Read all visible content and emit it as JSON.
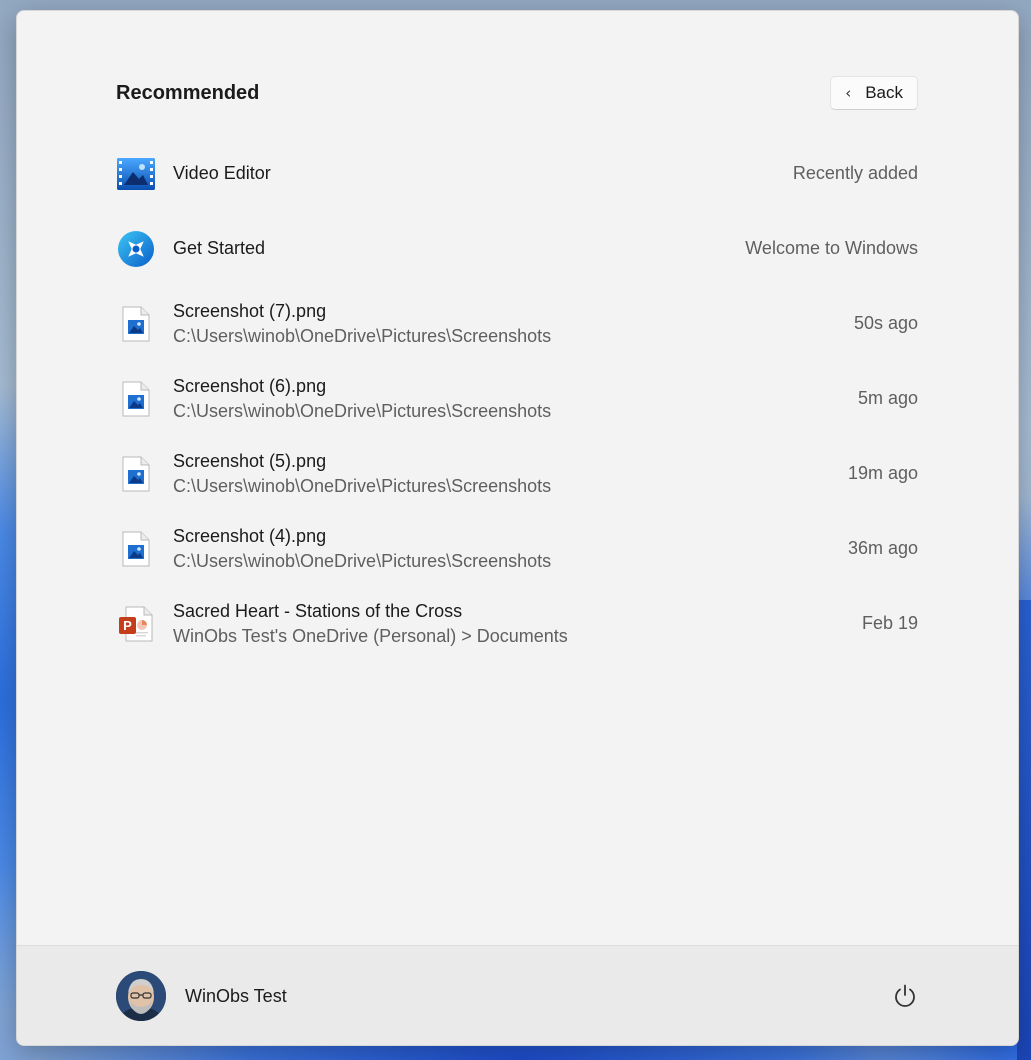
{
  "recommended": {
    "title": "Recommended",
    "back_label": "Back"
  },
  "items": [
    {
      "name": "Video Editor",
      "path": "",
      "meta": "Recently added",
      "icon": "video-editor-icon"
    },
    {
      "name": "Get Started",
      "path": "",
      "meta": "Welcome to Windows",
      "icon": "get-started-icon"
    },
    {
      "name": "Screenshot (7).png",
      "path": "C:\\Users\\winob\\OneDrive\\Pictures\\Screenshots",
      "meta": "50s ago",
      "icon": "image-file-icon"
    },
    {
      "name": "Screenshot (6).png",
      "path": "C:\\Users\\winob\\OneDrive\\Pictures\\Screenshots",
      "meta": "5m ago",
      "icon": "image-file-icon"
    },
    {
      "name": "Screenshot (5).png",
      "path": "C:\\Users\\winob\\OneDrive\\Pictures\\Screenshots",
      "meta": "19m ago",
      "icon": "image-file-icon"
    },
    {
      "name": "Screenshot (4).png",
      "path": "C:\\Users\\winob\\OneDrive\\Pictures\\Screenshots",
      "meta": "36m ago",
      "icon": "image-file-icon"
    },
    {
      "name": "Sacred Heart - Stations of the Cross",
      "path": "WinObs Test's OneDrive (Personal) > Documents",
      "meta": "Feb 19",
      "icon": "powerpoint-file-icon"
    }
  ],
  "footer": {
    "user_name": "WinObs Test",
    "power_icon": "power-icon"
  },
  "colors": {
    "panel_background": "#f3f3f3",
    "footer_background": "#eaeaea",
    "primary_text": "#1b1b1b",
    "secondary_text": "#5f5f5f",
    "accent_blue": "#0a6ed1",
    "powerpoint_red": "#c43e1c"
  }
}
